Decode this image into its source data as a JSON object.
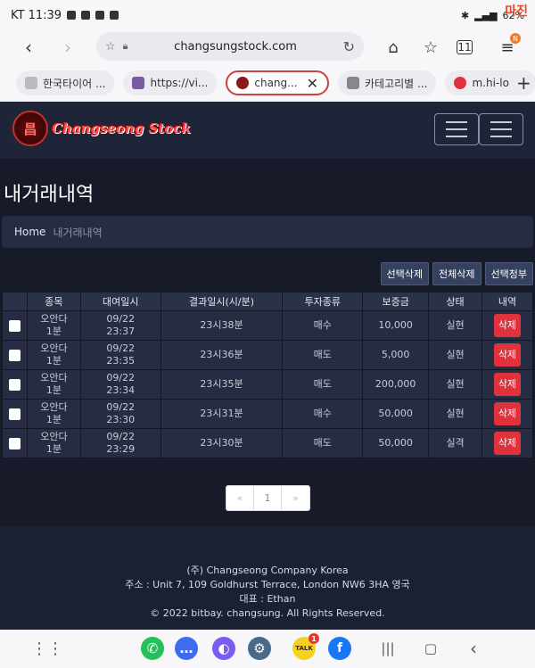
{
  "status_bar": {
    "carrier_time": "KT 11:39",
    "battery": "62%",
    "watermark": "마진"
  },
  "browser": {
    "url": "changsungstock.com",
    "tabs": [
      {
        "label": "한국타이어 ...",
        "active": false
      },
      {
        "label": "https://vi...",
        "active": false
      },
      {
        "label": "chang...",
        "active": true
      },
      {
        "label": "카테고리별 ...",
        "active": false
      },
      {
        "label": "m.hi-lo",
        "active": false
      }
    ],
    "menu_badge": "N"
  },
  "site": {
    "logo_text": "Changseong Stock",
    "logo_mark": "昌"
  },
  "page": {
    "title": "내거래내역",
    "breadcrumb_home": "Home",
    "breadcrumb_current": "내거래내역"
  },
  "actions": {
    "delete_selected": "선택삭제",
    "delete_all": "전체삭제",
    "request_selected": "선택청부"
  },
  "table": {
    "headers": [
      "종목",
      "대여일시",
      "결과일시(시/분)",
      "투자종류",
      "보증금",
      "상태",
      "내역"
    ],
    "rows": [
      {
        "item_line1": "오안다",
        "item_line2": "1분",
        "date": "09/22",
        "time": "23:37",
        "result": "23시38분",
        "type": "매수",
        "deposit": "10,000",
        "status": "실현",
        "status_ok": true,
        "action": "삭제"
      },
      {
        "item_line1": "오안다",
        "item_line2": "1분",
        "date": "09/22",
        "time": "23:35",
        "result": "23시36분",
        "type": "매도",
        "deposit": "5,000",
        "status": "실현",
        "status_ok": true,
        "action": "삭제"
      },
      {
        "item_line1": "오안다",
        "item_line2": "1분",
        "date": "09/22",
        "time": "23:34",
        "result": "23시35분",
        "type": "매도",
        "deposit": "200,000",
        "status": "실현",
        "status_ok": true,
        "action": "삭제"
      },
      {
        "item_line1": "오안다",
        "item_line2": "1분",
        "date": "09/22",
        "time": "23:30",
        "result": "23시31분",
        "type": "매수",
        "deposit": "50,000",
        "status": "실현",
        "status_ok": true,
        "action": "삭제"
      },
      {
        "item_line1": "오안다",
        "item_line2": "1분",
        "date": "09/22",
        "time": "23:29",
        "result": "23시30분",
        "type": "매도",
        "deposit": "50,000",
        "status": "실격",
        "status_ok": false,
        "action": "삭제"
      }
    ],
    "status_colors": {
      "ok": "#3fbf63",
      "bad": "#e23a3a"
    }
  },
  "pagination": {
    "prev": "«",
    "current": "1",
    "next": "»"
  },
  "footer": {
    "company": "(주) Changseong Company Korea",
    "address": "주소 : Unit 7, 109 Goldhurst Terrace, London NW6 3HA 영국",
    "ceo": "대표 : Ethan",
    "copyright": "© 2022 bitbay. changsung. All Rights Reserved."
  },
  "nav_bar": {
    "talk_badge": "1",
    "talk_label": "TALK"
  }
}
